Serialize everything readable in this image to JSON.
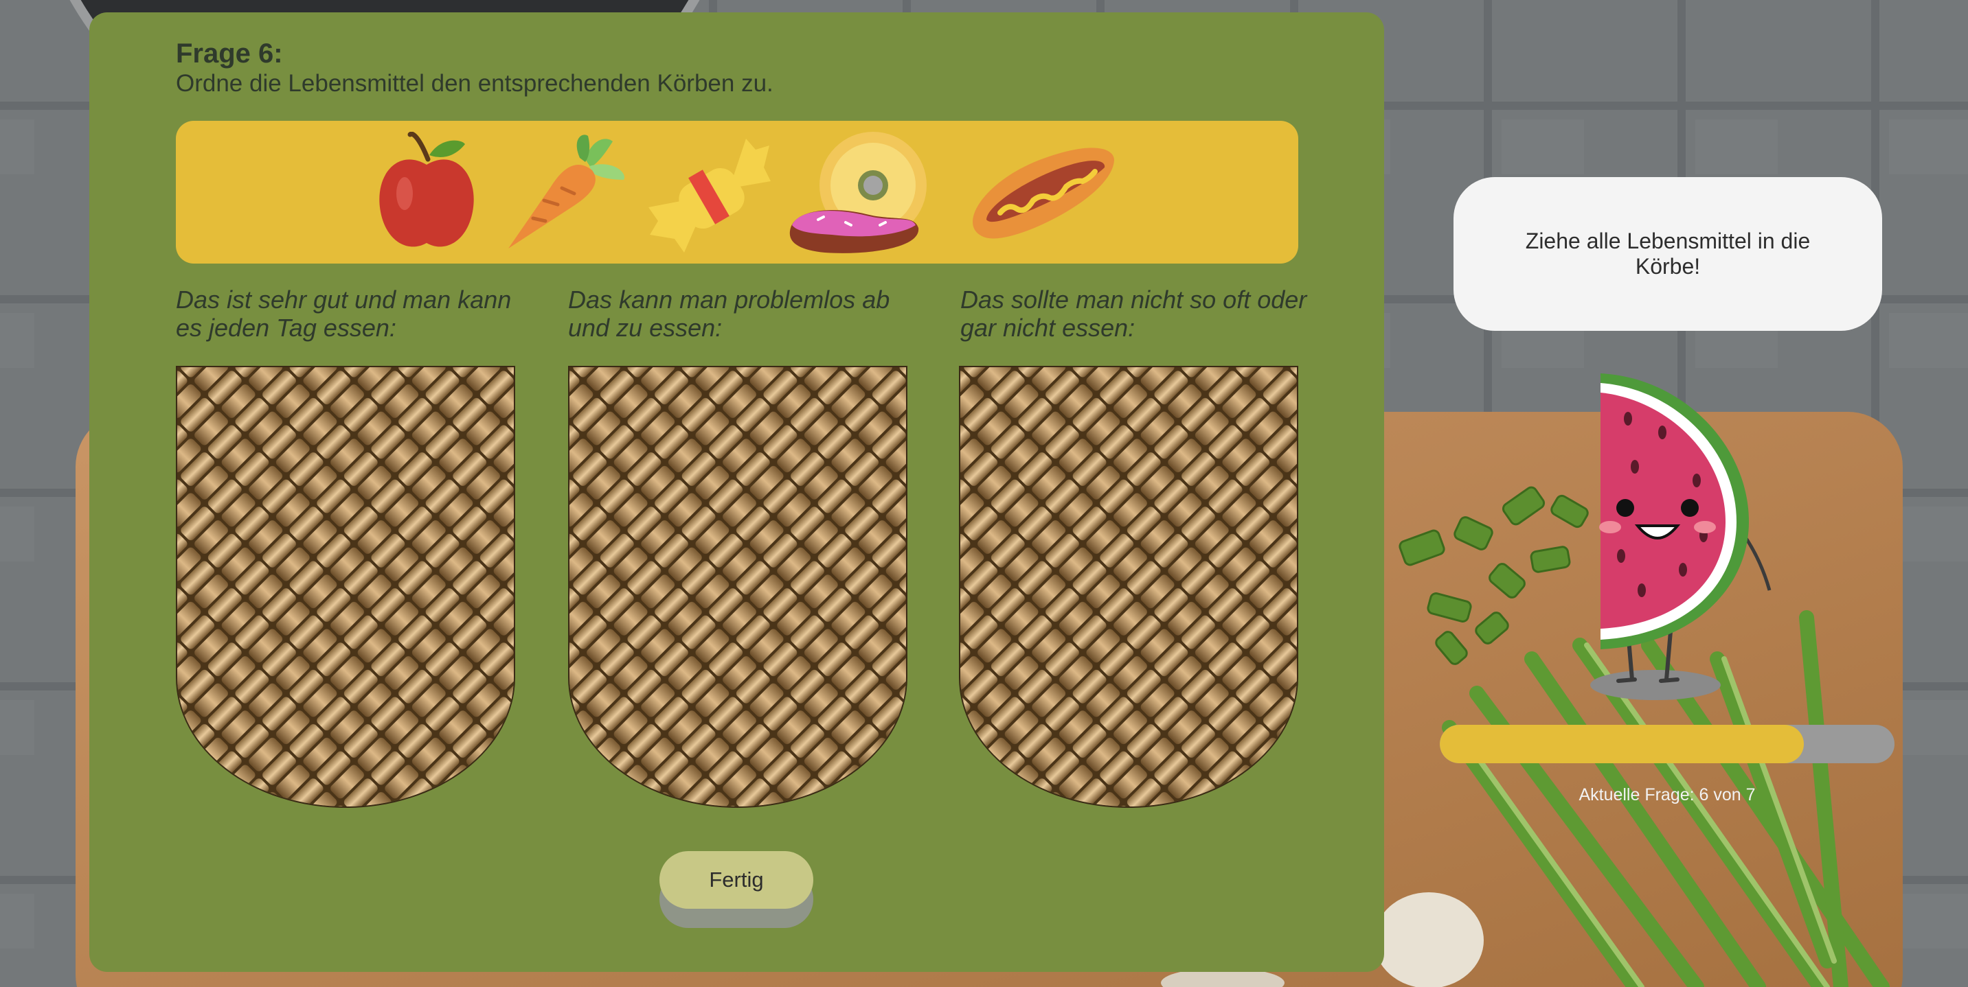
{
  "question": {
    "title": "Frage 6:",
    "instruction": "Ordne die Lebensmittel den entsprechenden Körben zu."
  },
  "foods": [
    {
      "name": "apple-icon"
    },
    {
      "name": "carrot-icon"
    },
    {
      "name": "candy-icon"
    },
    {
      "name": "donut-icon"
    },
    {
      "name": "hotdog-icon"
    }
  ],
  "baskets": [
    {
      "label": "Das ist sehr gut und man kann es jeden Tag essen:"
    },
    {
      "label": "Das kann man problemlos ab und zu essen:"
    },
    {
      "label": "Das sollte man nicht so oft oder gar nicht essen:"
    }
  ],
  "done_button": {
    "label": "Fertig"
  },
  "hint": {
    "text": "Ziehe alle Lebensmittel in die Körbe!"
  },
  "progress": {
    "current": 6,
    "total": 7,
    "fraction": 0.8,
    "label": "Aktuelle Frage: 6 von 7"
  },
  "colors": {
    "panel": "#788f40",
    "food_bar": "#e5bd39",
    "button": "#c8c886",
    "progress_fill": "#e4bd39",
    "progress_track": "#9a9a9a"
  }
}
